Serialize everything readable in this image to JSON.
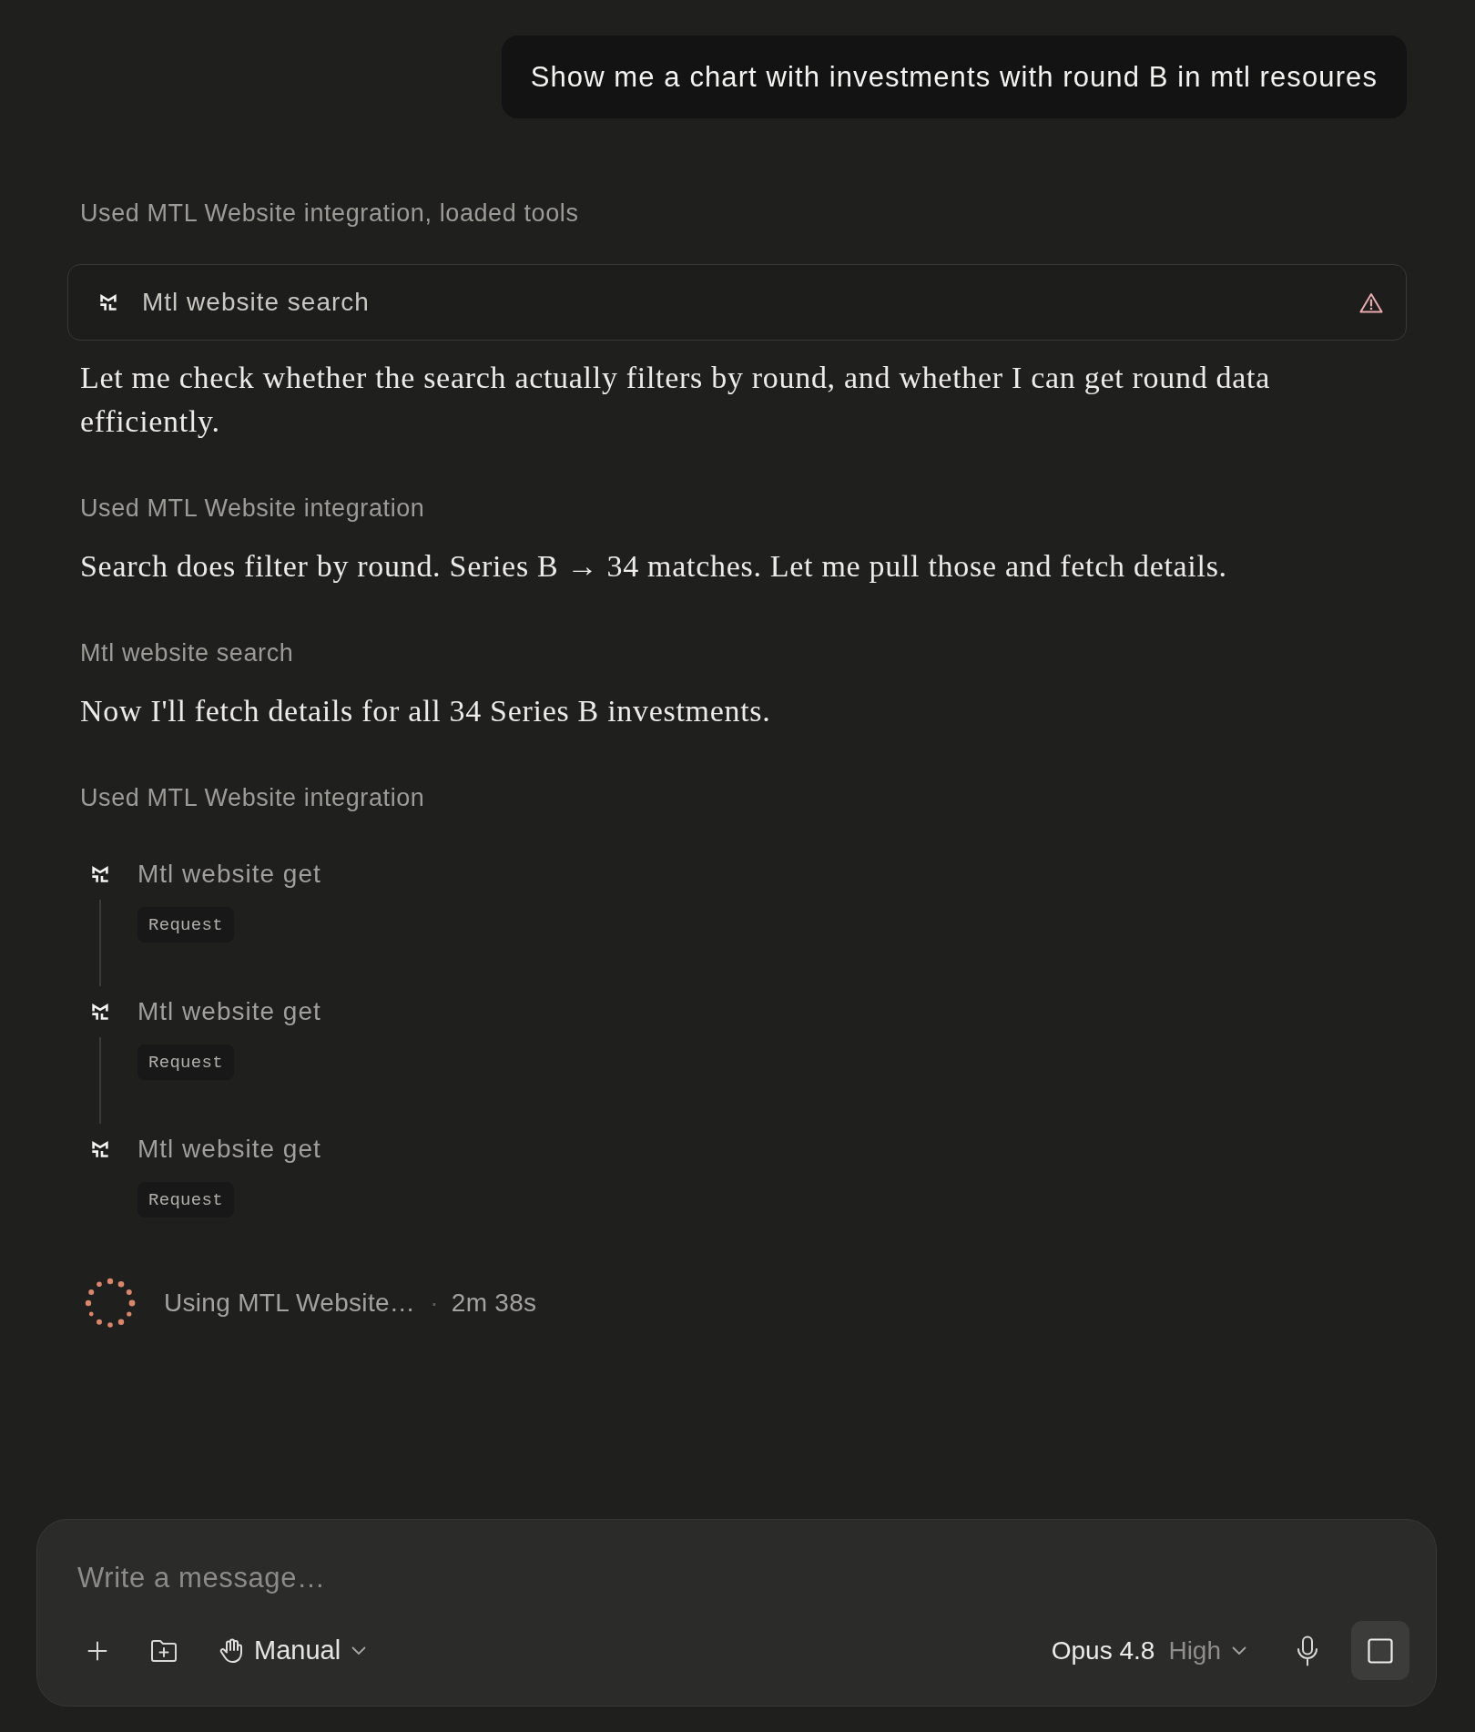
{
  "conversation": {
    "user_message": {
      "text": "Show me a chart with investments with round B in mtl resoures"
    },
    "steps": [
      {
        "kind": "note",
        "text": "Used MTL Website integration, loaded tools"
      },
      {
        "kind": "tool_card",
        "label": "Mtl website search",
        "warning": true
      },
      {
        "kind": "paragraph",
        "text": "Let me check whether the search actually filters by round, and whether I can get round data efficiently."
      },
      {
        "kind": "note",
        "text": "Used MTL Website integration"
      },
      {
        "kind": "paragraph",
        "text": "Search does filter by round. Series B → 34 matches. Let me pull those and fetch details."
      },
      {
        "kind": "note",
        "text": "Mtl website search"
      },
      {
        "kind": "paragraph",
        "text": "Now I'll fetch details for all 34 Series B investments."
      },
      {
        "kind": "note",
        "text": "Used MTL Website integration"
      },
      {
        "kind": "tool_calls",
        "items": [
          {
            "label": "Mtl website get",
            "tag": "Request"
          },
          {
            "label": "Mtl website get",
            "tag": "Request"
          },
          {
            "label": "Mtl website get",
            "tag": "Request"
          }
        ]
      },
      {
        "kind": "status",
        "text": "Using MTL Website…",
        "separator": "·",
        "elapsed": "2m 38s"
      }
    ]
  },
  "composer": {
    "placeholder": "Write a message…",
    "mode": "Manual",
    "model": "Opus 4.8",
    "effort": "High"
  }
}
